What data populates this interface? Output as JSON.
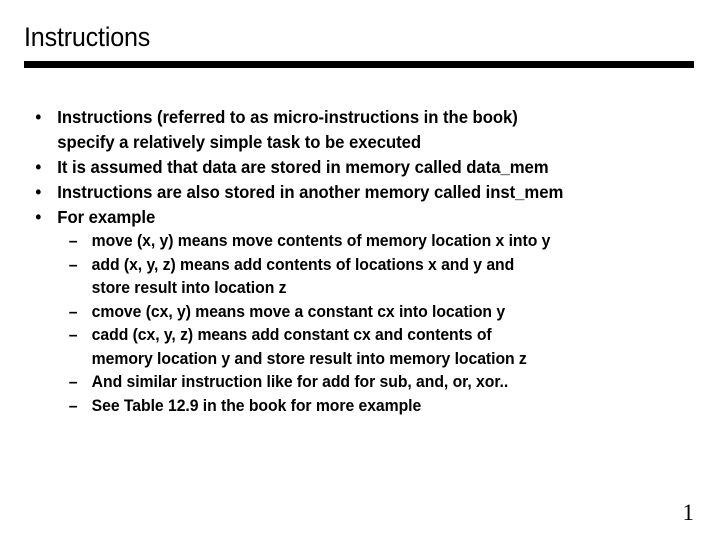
{
  "slide": {
    "title": "Instructions",
    "page_number": "1",
    "accent_color": "#000000",
    "background_color": "#ffffff",
    "text_color": "#000000",
    "bullet_marker": "•",
    "dash_marker": "–",
    "bullets": [
      {
        "level": 1,
        "lines": [
          "Instructions (referred to as micro-instructions in the book)",
          "specify a relatively simple task to be executed"
        ]
      },
      {
        "level": 1,
        "lines": [
          "It is assumed that data are stored in memory called data_mem"
        ]
      },
      {
        "level": 1,
        "lines": [
          "Instructions are also stored in another memory called inst_mem"
        ]
      },
      {
        "level": 1,
        "lines": [
          "For example"
        ]
      },
      {
        "level": 2,
        "lines": [
          "move (x, y) means move contents of memory location x into y"
        ]
      },
      {
        "level": 2,
        "lines": [
          "add (x, y, z) means add contents of locations x and y and",
          "store result into location z"
        ]
      },
      {
        "level": 2,
        "lines": [
          "cmove (cx, y) means move a constant cx into location y"
        ]
      },
      {
        "level": 2,
        "lines": [
          "cadd (cx, y, z) means add constant cx and contents of",
          "memory location y and store result into memory location z"
        ]
      },
      {
        "level": 2,
        "lines": [
          "And similar instruction like for add for sub, and, or, xor.."
        ]
      },
      {
        "level": 2,
        "lines": [
          "See Table 12.9 in the book for more example"
        ]
      }
    ]
  }
}
